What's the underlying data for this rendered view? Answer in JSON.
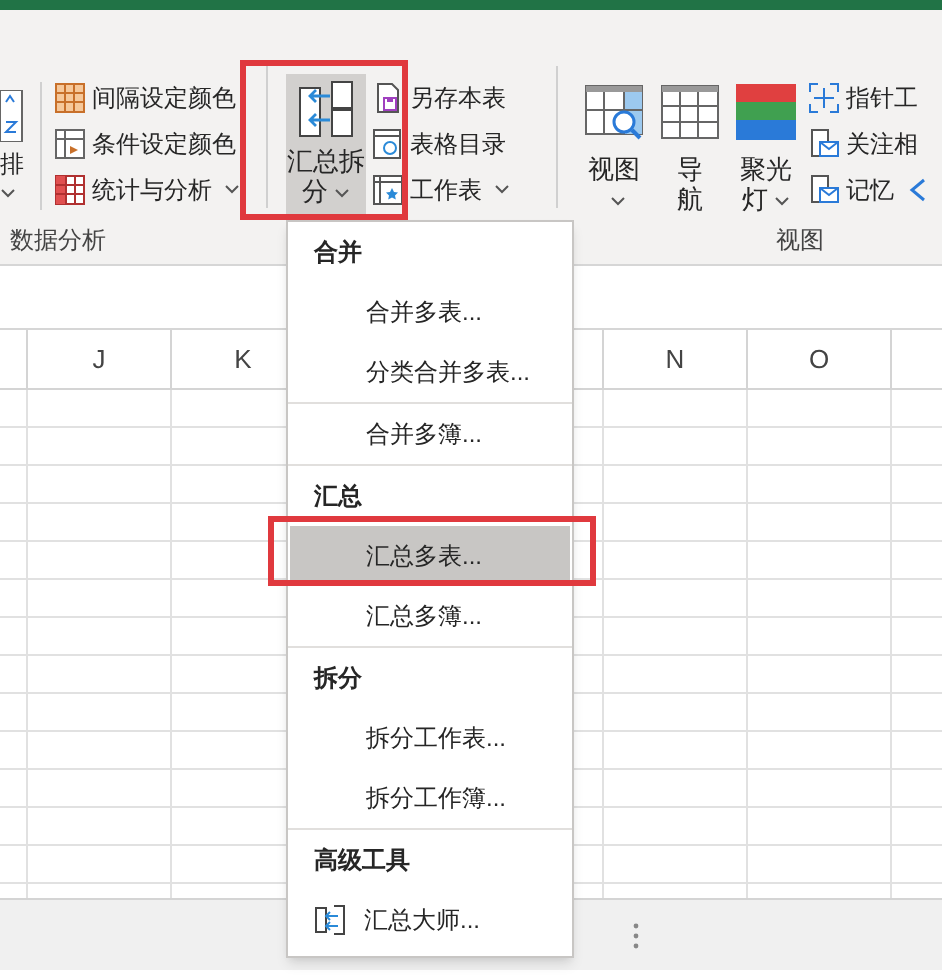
{
  "ribbon": {
    "groups": [
      {
        "kind": "analysis",
        "label": "数据分析",
        "partial_button": {
          "label": "排"
        },
        "items": [
          {
            "label": "间隔设定颜色",
            "dropdown": false
          },
          {
            "label": "条件设定颜色",
            "dropdown": false
          },
          {
            "label": "统计与分析",
            "dropdown": true
          }
        ]
      },
      {
        "kind": "merge",
        "big_button": {
          "label": "汇总拆分",
          "pressed": true
        },
        "items": [
          {
            "label": "另存本表",
            "dropdown": false
          },
          {
            "label": "表格目录",
            "dropdown": false
          },
          {
            "label": "工作表",
            "dropdown": true
          }
        ]
      },
      {
        "kind": "view",
        "label": "视图",
        "buttons": [
          {
            "label": "视图",
            "dropdown": true
          },
          {
            "label": "导航",
            "dropdown": false
          },
          {
            "label": "聚光灯",
            "dropdown": true
          }
        ],
        "items": [
          {
            "label": "指针工"
          },
          {
            "label": "关注相"
          },
          {
            "label": "记忆"
          }
        ]
      }
    ]
  },
  "columns": [
    "J",
    "K",
    "N",
    "O"
  ],
  "dropdown_menu": [
    {
      "kind": "header",
      "label": "合并"
    },
    {
      "kind": "item",
      "label": "合并多表...",
      "selected": false
    },
    {
      "kind": "item",
      "label": "分类合并多表...",
      "selected": false
    },
    {
      "kind": "separator"
    },
    {
      "kind": "item",
      "label": "合并多簿...",
      "selected": false
    },
    {
      "kind": "separator"
    },
    {
      "kind": "header",
      "label": "汇总"
    },
    {
      "kind": "item",
      "label": "汇总多表...",
      "selected": true
    },
    {
      "kind": "item",
      "label": "汇总多簿...",
      "selected": false
    },
    {
      "kind": "separator"
    },
    {
      "kind": "header",
      "label": "拆分"
    },
    {
      "kind": "item",
      "label": "拆分工作表...",
      "selected": false
    },
    {
      "kind": "item",
      "label": "拆分工作簿...",
      "selected": false
    },
    {
      "kind": "separator"
    },
    {
      "kind": "header",
      "label": "高级工具"
    },
    {
      "kind": "icon_item",
      "label": "汇总大师...",
      "selected": false
    }
  ]
}
